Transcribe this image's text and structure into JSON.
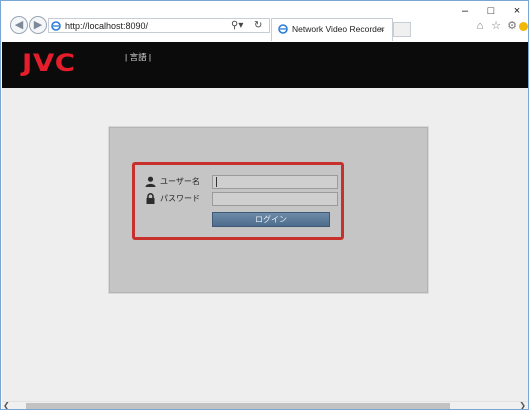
{
  "browser": {
    "url": "http://localhost:8090/",
    "search_icon": "search-icon",
    "refresh_icon": "refresh-icon",
    "tab_title": "Network Video Recorder",
    "tab_close": "×",
    "back_icon": "back-arrow-icon",
    "forward_icon": "forward-arrow-icon",
    "minimize": "–",
    "maximize": "□",
    "close": "×"
  },
  "app": {
    "logo": "JVC",
    "language_menu": "| 言語 |"
  },
  "login": {
    "username_label": "ユーザー名",
    "username_value": "",
    "password_label": "パスワード",
    "password_value": "",
    "login_button": "ログイン"
  },
  "colors": {
    "logo_red": "#e61e2b",
    "header_black": "#0b0b0b",
    "highlight_red": "#c8312b",
    "button_blue": "#5b7a9b"
  }
}
